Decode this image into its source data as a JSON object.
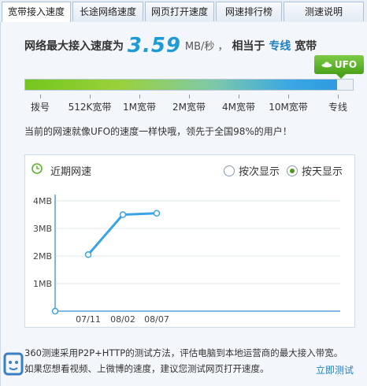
{
  "tabs": [
    {
      "label": "宽带接入速度",
      "active": true
    },
    {
      "label": "长途网络速度",
      "active": false
    },
    {
      "label": "网页打开速度",
      "active": false
    },
    {
      "label": "网速排行榜",
      "active": false
    },
    {
      "label": "测速说明",
      "active": false
    }
  ],
  "headline": {
    "prefix": "网络最大接入速度为",
    "speed": "3.59",
    "unit": "MB/秒 ，",
    "mid": "相当于",
    "level": "专线",
    "suffix": "宽带"
  },
  "badge": {
    "label": "UFO",
    "icon": "ufo-icon",
    "color": "#5cb22a"
  },
  "progress": {
    "value": 0.952
  },
  "scale_labels": [
    "拨号",
    "512K宽带",
    "1M宽带",
    "2M宽带",
    "4M宽带",
    "10M宽带",
    "专线"
  ],
  "compare_text": "当前的网速就像UFO的速度一样快哦，领先于全国98%的用户！",
  "chart_card": {
    "title": "近期网速",
    "radio_options": [
      {
        "label": "按次显示",
        "selected": false
      },
      {
        "label": "按天显示",
        "selected": true
      }
    ]
  },
  "chart_data": {
    "type": "line",
    "x": [
      "07/11",
      "08/02",
      "08/07"
    ],
    "values": [
      2.05,
      3.5,
      3.55
    ],
    "y_tick_labels": [
      "4MB",
      "3MB",
      "2MB",
      "1MB"
    ],
    "ylim": [
      0,
      4
    ],
    "grid": true,
    "line_color": "#3aa3e3"
  },
  "footer": {
    "line1": "360测速采用P2P+HTTP的测试方法，评估电脑到本地运营商的最大接入带宽。",
    "line2": "如果您想看视频、上微博的速度，建议您测试网页打开速度。",
    "link": "立即测试"
  }
}
